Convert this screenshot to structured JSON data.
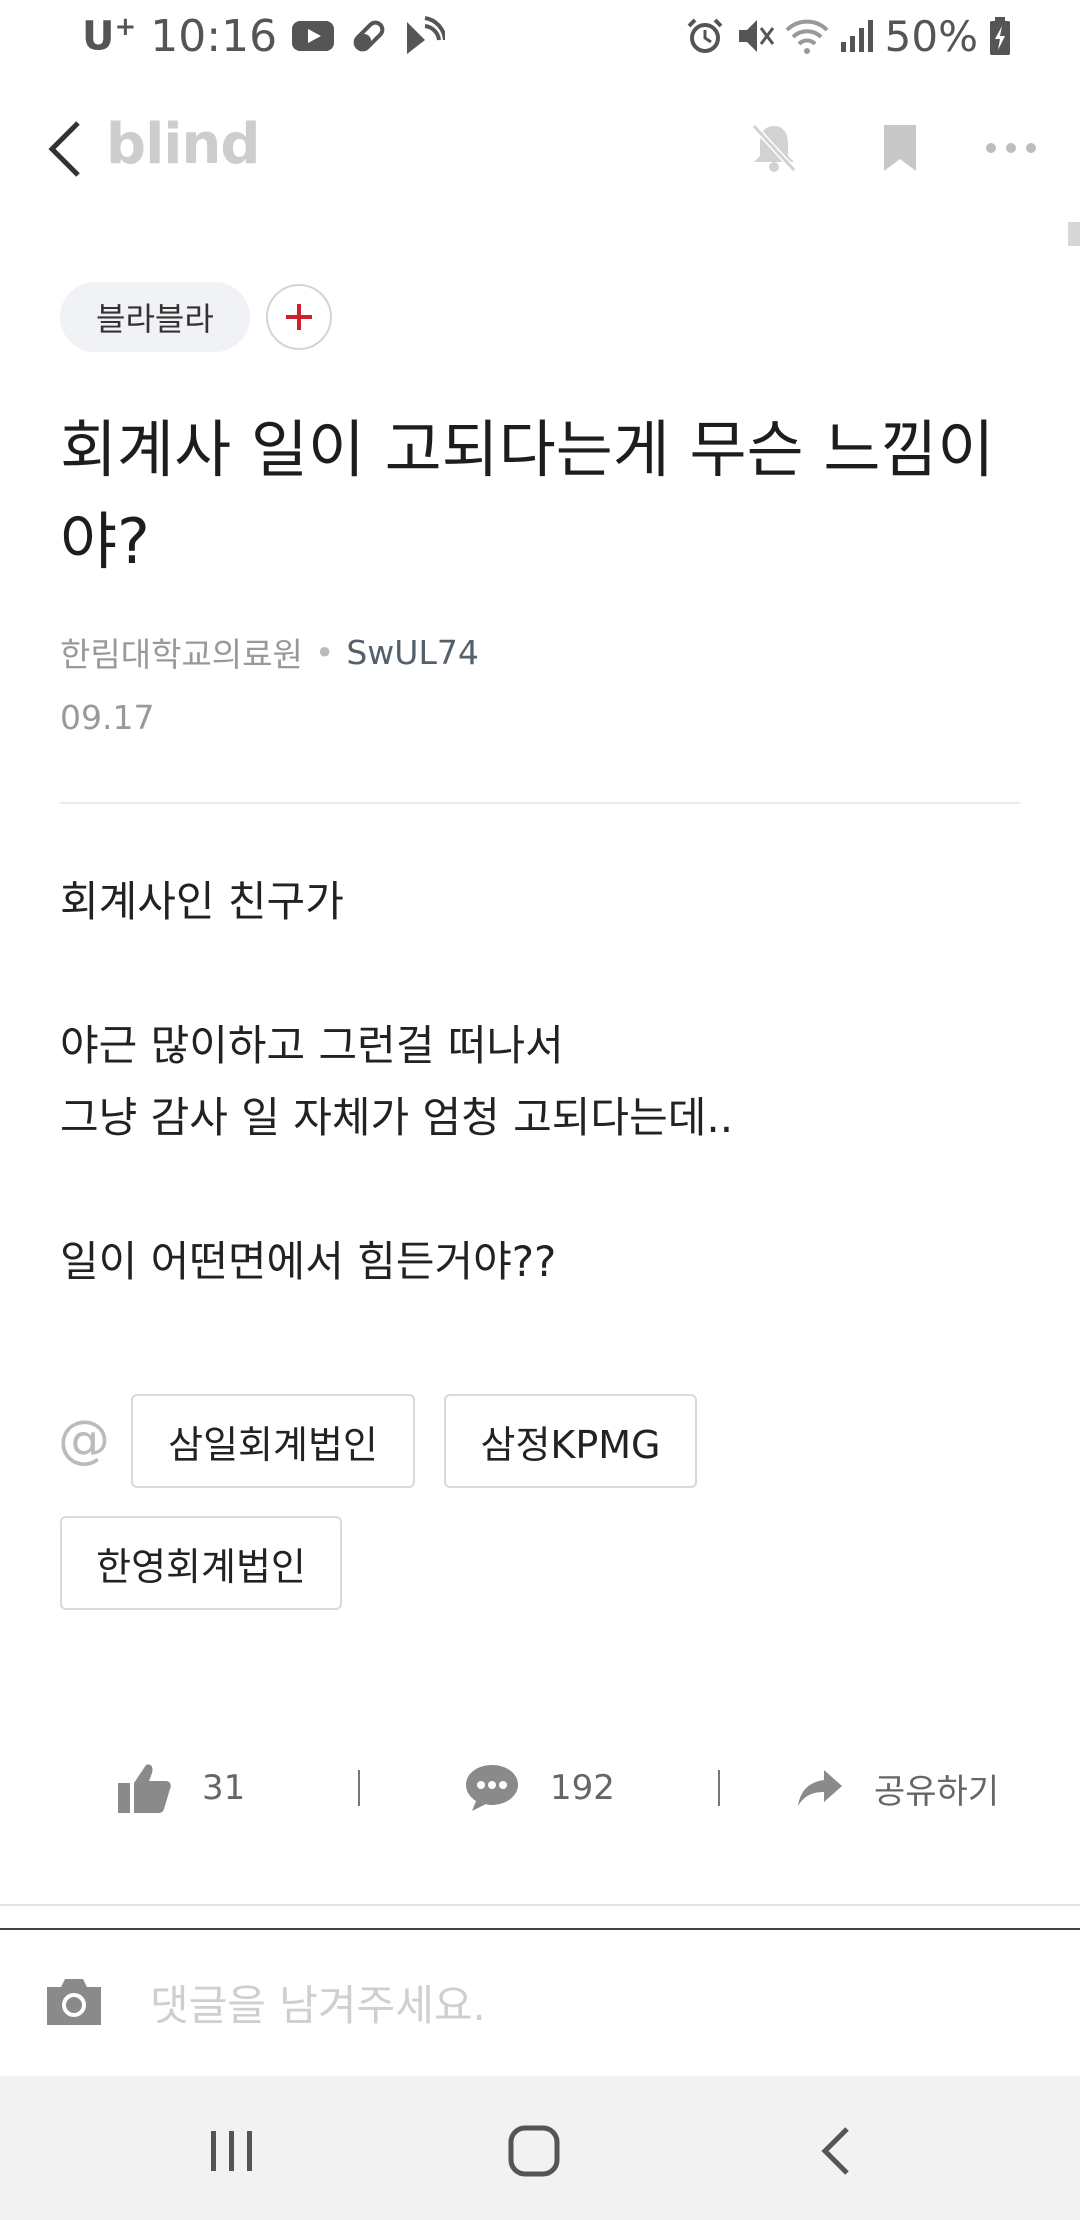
{
  "status_bar": {
    "carrier": "U",
    "carrier_sup": "+",
    "time": "10:16",
    "battery": "50%",
    "icons_left": [
      "youtube-icon",
      "pill-icon",
      "cast-icon"
    ],
    "icons_right": [
      "alarm-icon",
      "mute-icon",
      "wifi-icon",
      "signal-icon",
      "battery-icon"
    ]
  },
  "app_bar": {
    "brand": "blind",
    "icons": [
      "back-icon",
      "notification-off-icon",
      "bookmark-icon",
      "more-icon"
    ]
  },
  "post": {
    "board": "블라블라",
    "title": "회계사 일이 고되다는게 무슨 느낌이야?",
    "company": "한림대학교의료원",
    "separator": "•",
    "nickname": "SwUL74",
    "date": "09.17",
    "body": [
      "회계사인 친구가",
      "",
      "야근 많이하고 그런걸 떠나서",
      "그냥 감사 일 자체가 엄청 고되다는데..",
      "",
      "일이 어떤면에서 힘든거야??"
    ],
    "at_symbol": "@",
    "company_tags": [
      "삼일회계법인",
      "삼정KPMG",
      "한영회계법인"
    ]
  },
  "actions": {
    "likes": "31",
    "comments": "192",
    "share_label": "공유하기"
  },
  "comment": {
    "placeholder": "댓글을 남겨주세요."
  },
  "colors": {
    "accent_red": "#d0202c",
    "brand_gray": "#cdcdcd",
    "icon_gray": "#8a8a8a"
  }
}
